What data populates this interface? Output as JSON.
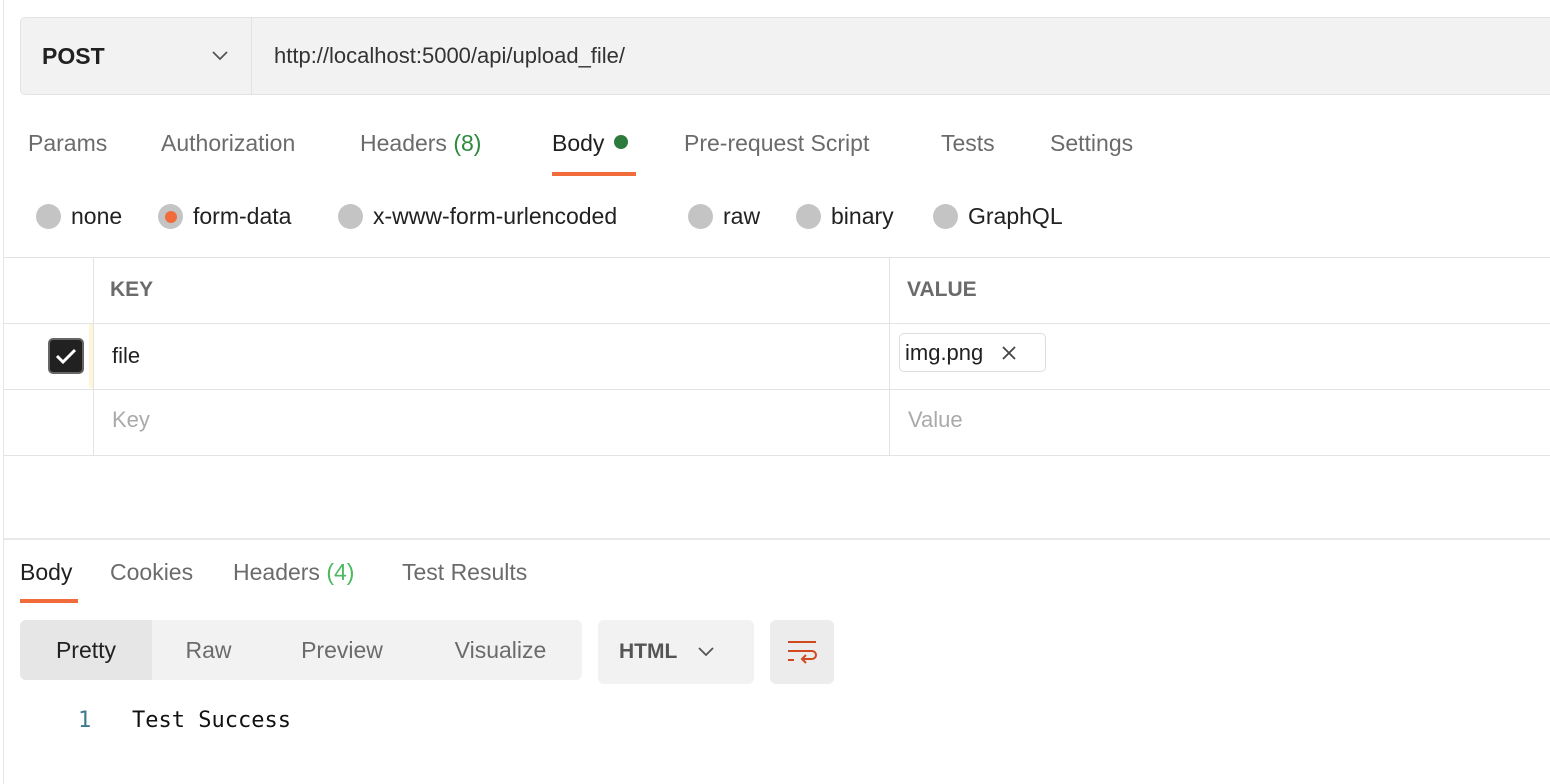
{
  "request": {
    "method": "POST",
    "url": "http://localhost:5000/api/upload_file/"
  },
  "request_tabs": [
    {
      "label": "Params"
    },
    {
      "label": "Authorization"
    },
    {
      "label": "Headers",
      "count": "(8)"
    },
    {
      "label": "Body",
      "active": true
    },
    {
      "label": "Pre-request Script"
    },
    {
      "label": "Tests"
    },
    {
      "label": "Settings"
    }
  ],
  "body_types": [
    {
      "label": "none"
    },
    {
      "label": "form-data",
      "selected": true
    },
    {
      "label": "x-www-form-urlencoded"
    },
    {
      "label": "raw"
    },
    {
      "label": "binary"
    },
    {
      "label": "GraphQL"
    }
  ],
  "table": {
    "headers": {
      "key": "KEY",
      "value": "VALUE"
    },
    "rows": [
      {
        "checked": true,
        "key": "file",
        "value": "img.png"
      }
    ],
    "placeholder": {
      "key": "Key",
      "value": "Value"
    }
  },
  "response_tabs": [
    {
      "label": "Body",
      "active": true
    },
    {
      "label": "Cookies"
    },
    {
      "label": "Headers",
      "count": "(4)"
    },
    {
      "label": "Test Results"
    }
  ],
  "view_modes": [
    {
      "label": "Pretty",
      "active": true
    },
    {
      "label": "Raw"
    },
    {
      "label": "Preview"
    },
    {
      "label": "Visualize"
    }
  ],
  "format": "HTML",
  "response_lines": [
    {
      "number": "1",
      "text": "Test Success"
    }
  ],
  "colors": {
    "accent": "#f26b3a",
    "indicator_green": "#2c7b3c"
  }
}
